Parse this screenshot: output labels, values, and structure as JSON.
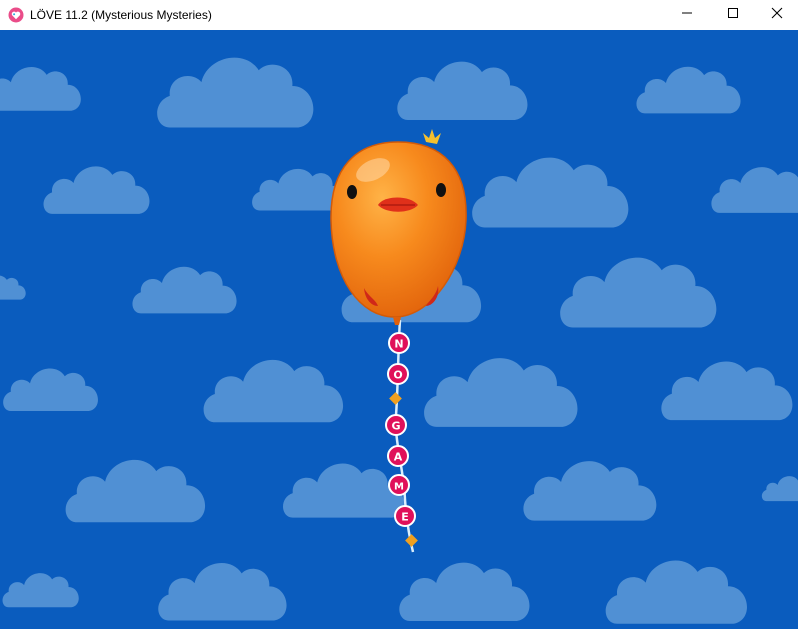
{
  "window": {
    "title": "LÖVE 11.2 (Mysterious Mysteries)",
    "icon": "love-heart-icon",
    "controls": {
      "minimize": "minimize-icon",
      "maximize": "maximize-icon",
      "close": "close-icon"
    }
  },
  "game": {
    "background_color": "#0a5cbe",
    "cloud_color": "#5090d4",
    "balloon_color": "#f07010",
    "letter_badge_color": "#e0105a",
    "string_letters": [
      "N",
      "O",
      "G",
      "A",
      "M",
      "E"
    ]
  }
}
